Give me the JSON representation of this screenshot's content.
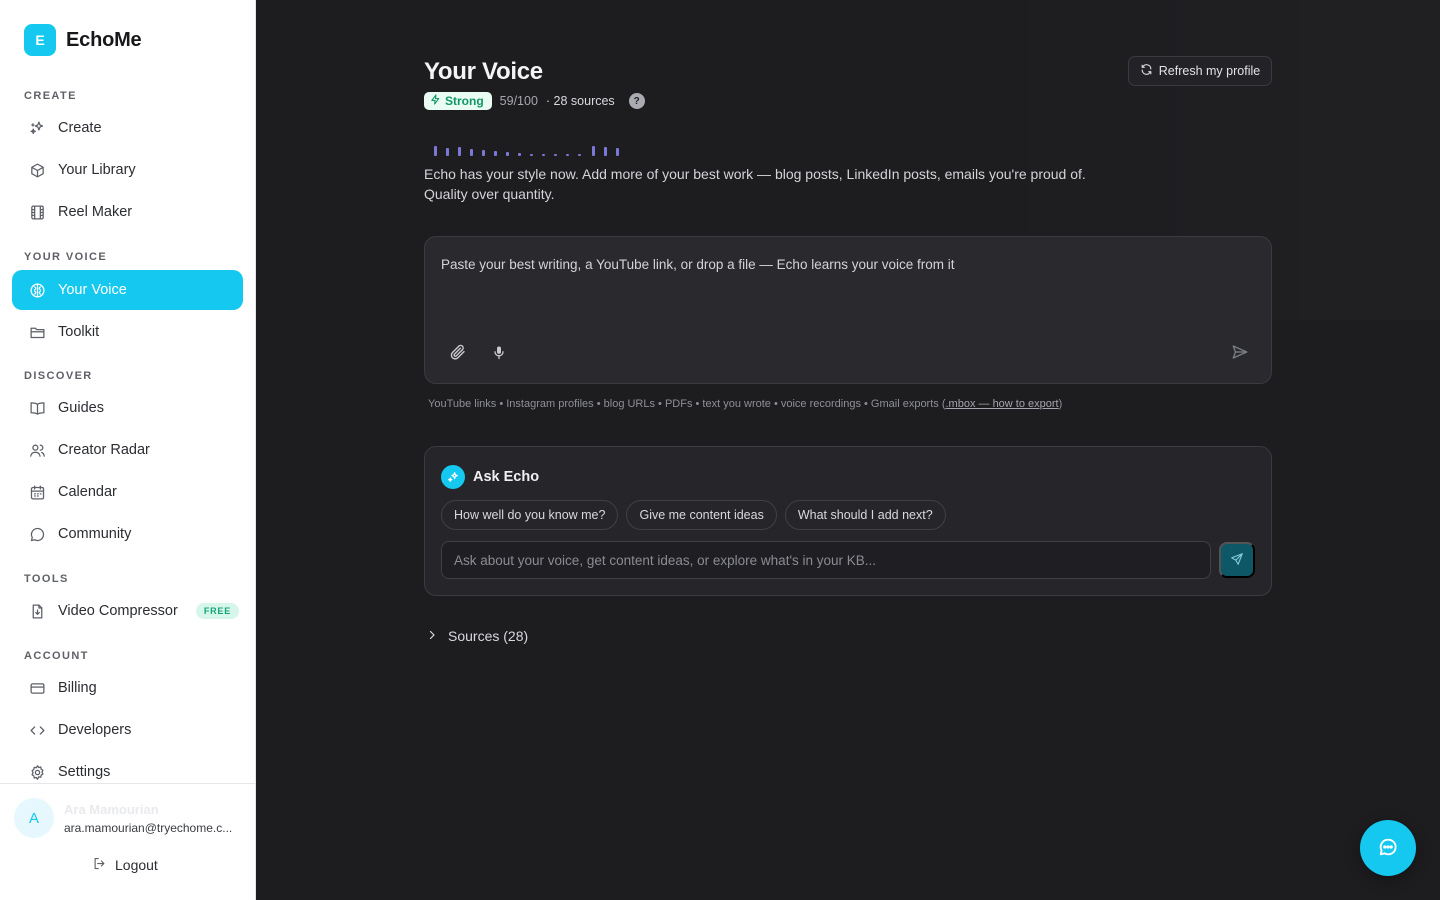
{
  "brand": {
    "logo_letter": "E",
    "name": "EchoMe"
  },
  "sidebar": {
    "sections": {
      "create": "CREATE",
      "your_voice": "YOUR VOICE",
      "discover": "DISCOVER",
      "tools": "TOOLS",
      "account": "ACCOUNT"
    },
    "items": [
      {
        "label": "Create",
        "icon": "sparkle-icon"
      },
      {
        "label": "Your Library",
        "icon": "box-icon"
      },
      {
        "label": "Reel Maker",
        "icon": "film-icon"
      },
      {
        "label": "Your Voice",
        "icon": "brain-icon",
        "active": true
      },
      {
        "label": "Toolkit",
        "icon": "folder-icon"
      },
      {
        "label": "Guides",
        "icon": "book-icon"
      },
      {
        "label": "Creator Radar",
        "icon": "users-icon"
      },
      {
        "label": "Calendar",
        "icon": "calendar-icon"
      },
      {
        "label": "Community",
        "icon": "chat-icon"
      },
      {
        "label": "Video Compressor",
        "icon": "file-down-icon",
        "badge": "FREE"
      },
      {
        "label": "Billing",
        "icon": "credit-card-icon"
      },
      {
        "label": "Developers",
        "icon": "code-icon"
      },
      {
        "label": "Settings",
        "icon": "gear-icon"
      }
    ],
    "user": {
      "initial": "A",
      "name": "Ara Mamourian",
      "email": "ara.mamourian@tryechome.c..."
    },
    "logout_label": "Logout"
  },
  "main": {
    "title": "Your Voice",
    "strength_label": "Strong",
    "score": "59/100",
    "sources_text": "· 28 sources",
    "help": "?",
    "refresh_label": "Refresh my profile",
    "description": "Echo has your style now. Add more of your best work — blog posts, LinkedIn posts, emails you're proud of. Quality over quantity.",
    "input_placeholder": "Paste your best writing, a YouTube link, or drop a file — Echo learns your voice from it",
    "hint_text": "YouTube links • Instagram profiles • blog URLs • PDFs • text you wrote • voice recordings • Gmail exports (",
    "hint_link": ".mbox — how to export",
    "hint_close": ")",
    "ask": {
      "title": "Ask Echo",
      "chips": [
        "How well do you know me?",
        "Give me content ideas",
        "What should I add next?"
      ],
      "placeholder": "Ask about your voice, get content ideas, or explore what's in your KB..."
    },
    "sources_toggle": "Sources (28)"
  },
  "colors": {
    "accent": "#14c8f0",
    "strong_badge_bg": "#e9fbf3",
    "strong_badge_text": "#119767",
    "main_bg": "#1d1d20",
    "waveform": "#7b78d8"
  }
}
